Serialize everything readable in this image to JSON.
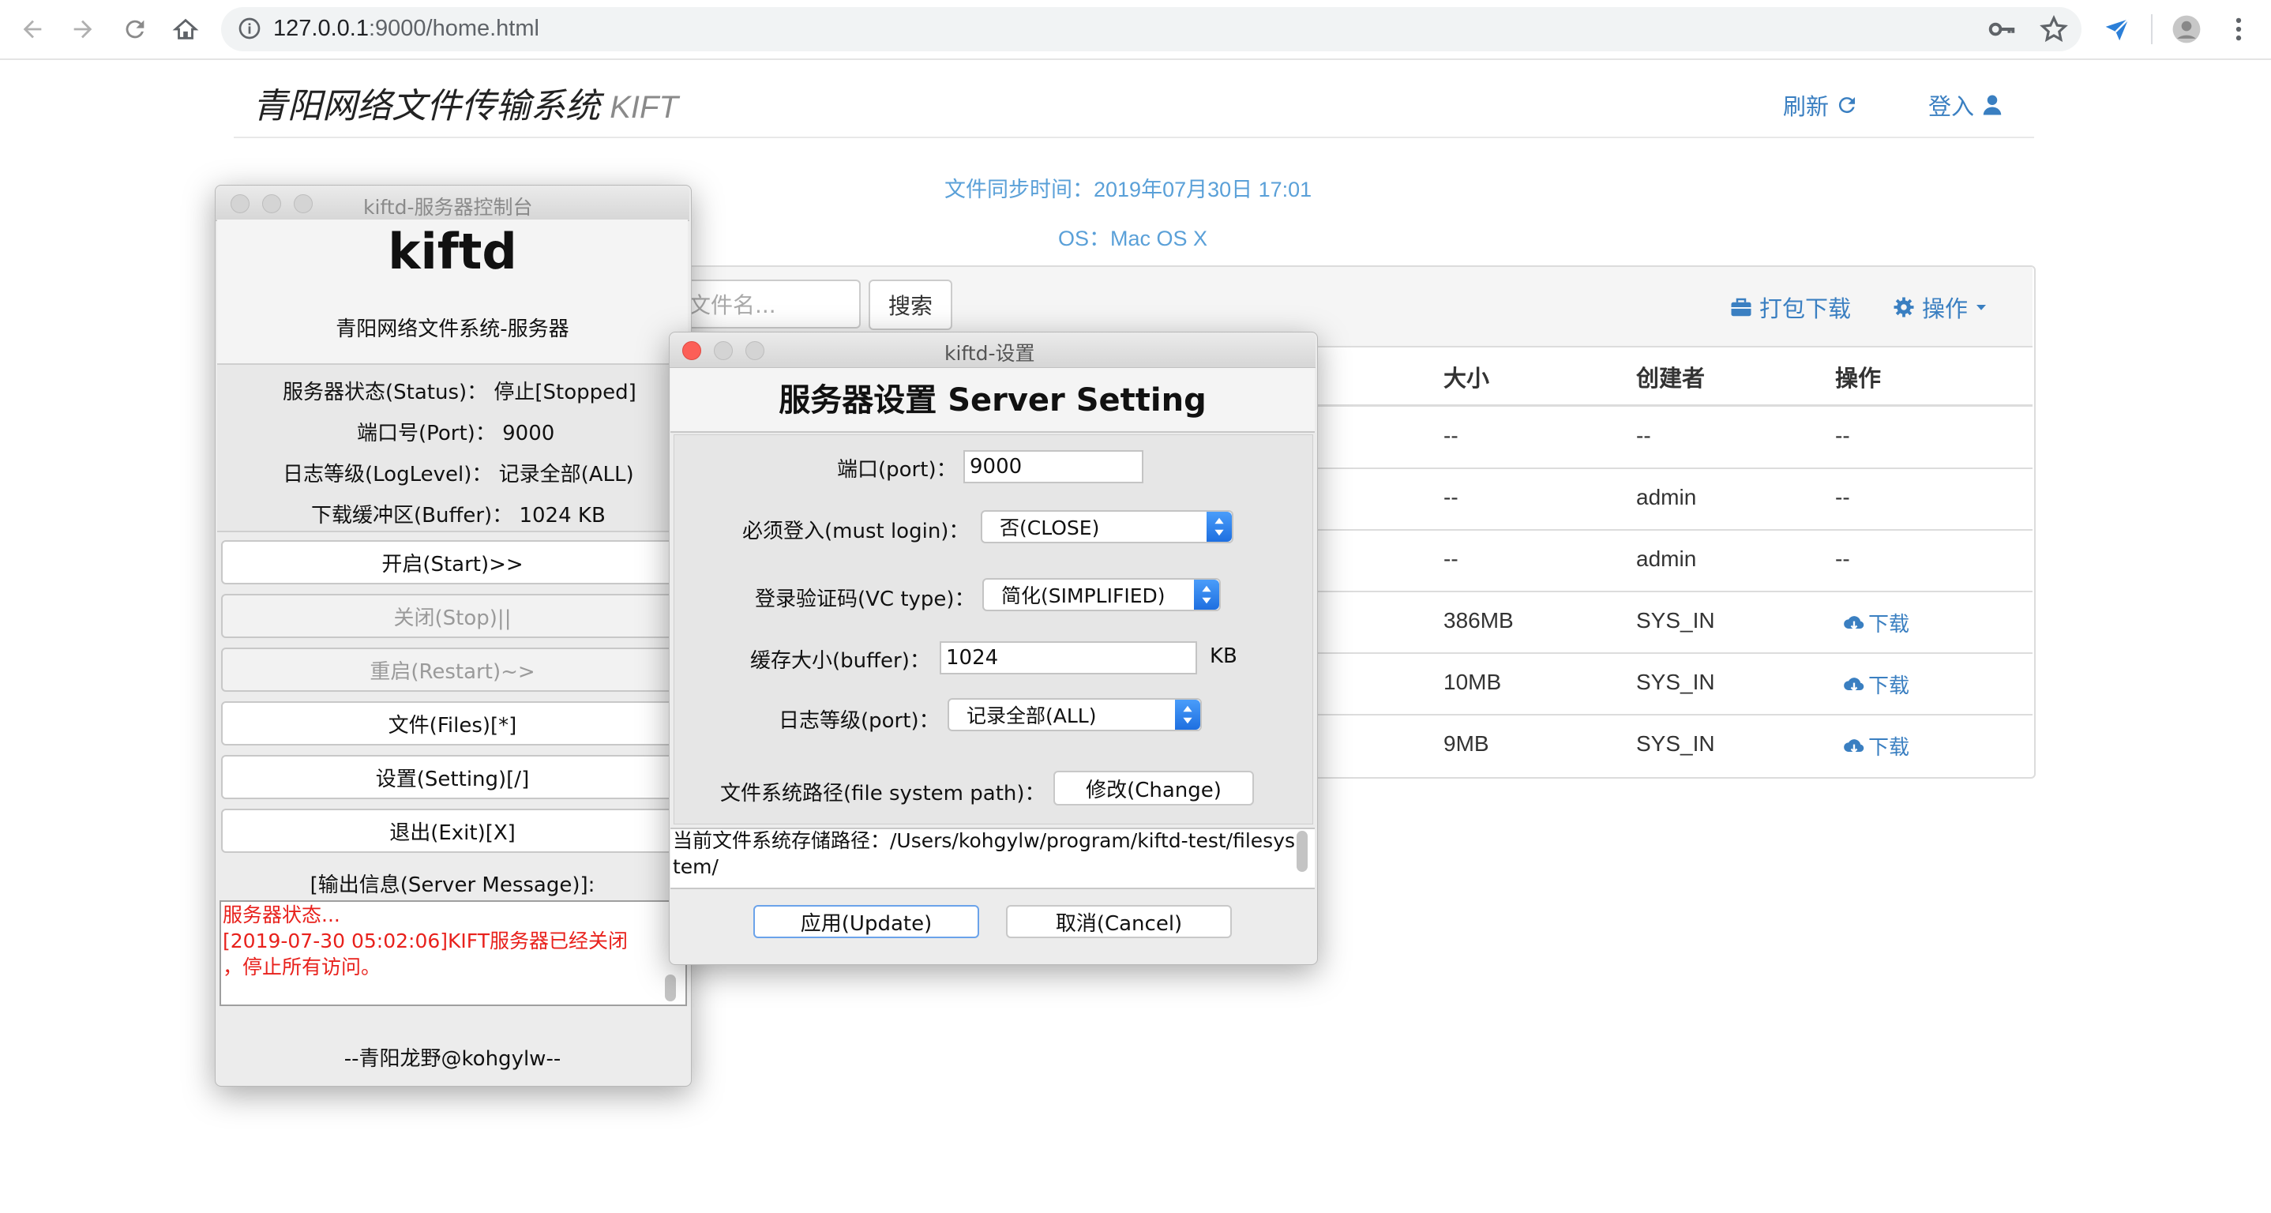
{
  "browser": {
    "url_host": "127.0.0.1",
    "url_rest": ":9000/home.html"
  },
  "page": {
    "title": "青阳网络文件传输系统",
    "title_suffix": "KIFT",
    "refresh_label": "刷新",
    "login_label": "登入",
    "sync_time": "文件同步时间：2019年07月30日 17:01",
    "os_info": "OS：Mac OS X",
    "search_placeholder": "文件名...",
    "search_button": "搜索",
    "pack_download": "打包下载",
    "actions_menu": "操作",
    "columns": {
      "size": "大小",
      "creator": "创建者",
      "ops": "操作"
    },
    "rows": [
      {
        "size": "--",
        "creator": "--",
        "op": "--"
      },
      {
        "size": "--",
        "creator": "admin",
        "op": "--"
      },
      {
        "size": "--",
        "creator": "admin",
        "op": "--"
      },
      {
        "size": "386MB",
        "creator": "SYS_IN",
        "op": "下载"
      },
      {
        "size": "10MB",
        "creator": "SYS_IN",
        "op": "下载"
      },
      {
        "size": "9MB",
        "creator": "SYS_IN",
        "op": "下载"
      }
    ]
  },
  "control_window": {
    "title": "kiftd-服务器控制台",
    "app_name": "kiftd",
    "subtitle": "青阳网络文件系统-服务器",
    "status_label": "服务器状态(Status)：",
    "status_value": "停止[Stopped]",
    "port_label": "端口号(Port)：",
    "port_value": "9000",
    "log_label": "日志等级(LogLevel)：",
    "log_value": "记录全部(ALL)",
    "buffer_label": "下载缓冲区(Buffer)：",
    "buffer_value": "1024 KB",
    "buttons": {
      "start": "开启(Start)>>",
      "stop": "关闭(Stop)||",
      "restart": "重启(Restart)~>",
      "files": "文件(Files)[*]",
      "setting": "设置(Setting)[/]",
      "exit": "退出(Exit)[X]"
    },
    "output_label": "[输出信息(Server Message)]:",
    "messages": [
      "服务器状态...",
      "[2019-07-30 05:02:06]KIFT服务器已经关闭",
      "，停止所有访问。"
    ],
    "footer": "--青阳龙野@kohgylw--"
  },
  "setting_window": {
    "title": "kiftd-设置",
    "heading": "服务器设置 Server Setting",
    "port_label": "端口(port)：",
    "port_value": "9000",
    "login_label": "必须登入(must login)：",
    "login_value": "否(CLOSE)",
    "vc_label": "登录验证码(VC type)：",
    "vc_value": "简化(SIMPLIFIED)",
    "buffer_label": "缓存大小(buffer)：",
    "buffer_value": "1024",
    "buffer_unit": "KB",
    "log_label": "日志等级(port)：",
    "log_value": "记录全部(ALL)",
    "path_label": "文件系统路径(file system path)：",
    "change_button": "修改(Change)",
    "path_text": "当前文件系统存储路径：/Users/kohgylw/program/kiftd-test/filesystem/",
    "update_button": "应用(Update)",
    "cancel_button": "取消(Cancel)"
  },
  "colors": {
    "link_blue": "#3a7fc1",
    "info_blue": "#5aa0d8",
    "message_red": "#e8211c",
    "select_blue": "#1e6fe0"
  },
  "icons": [
    "back-icon",
    "forward-icon",
    "reload-icon",
    "home-icon",
    "info-icon",
    "key-icon",
    "star-icon",
    "extension-icon",
    "profile-icon",
    "menu-icon",
    "refresh-icon",
    "user-icon",
    "briefcase-icon",
    "gear-icon",
    "caret-down-icon",
    "cloud-download-icon"
  ]
}
